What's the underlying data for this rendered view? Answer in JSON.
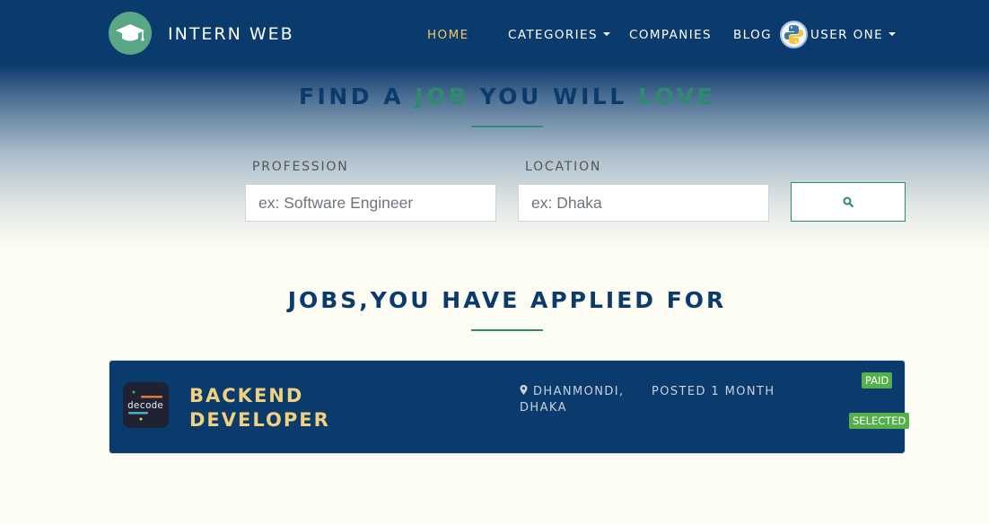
{
  "brand": {
    "name": "INTERN WEB",
    "logo_icon": "graduation-cap-icon"
  },
  "nav": {
    "home": "HOME",
    "categories": "CATEGORIES",
    "companies": "COMPANIES",
    "blog": "BLOG",
    "user": "USER ONE",
    "user_avatar_icon": "python-logo-icon"
  },
  "hero": {
    "title_part1": "FIND A ",
    "title_part2": "JOB",
    "title_part3": " YOU WILL ",
    "title_part4": "LOVE"
  },
  "search": {
    "profession_label": "PROFESSION",
    "profession_placeholder": "ex: Software Engineer",
    "location_label": "LOCATION",
    "location_placeholder": "ex: Dhaka",
    "button_icon": "search-icon"
  },
  "applied": {
    "title": "JOBS,YOU HAVE APPLIED FOR",
    "jobs": [
      {
        "title": "BACKEND DEVELOPER",
        "location": "DHANMONDI, DHAKA",
        "posted": "POSTED 1 MONTH",
        "company_logo_text": "decode",
        "badge_paid": "PAID",
        "badge_status": "SELECTED"
      }
    ]
  },
  "colors": {
    "primary": "#0b3a6d",
    "accent": "#2e8b70",
    "gold": "#f0d27c",
    "badge_green": "#54b04a",
    "background": "#fdfdf4"
  }
}
